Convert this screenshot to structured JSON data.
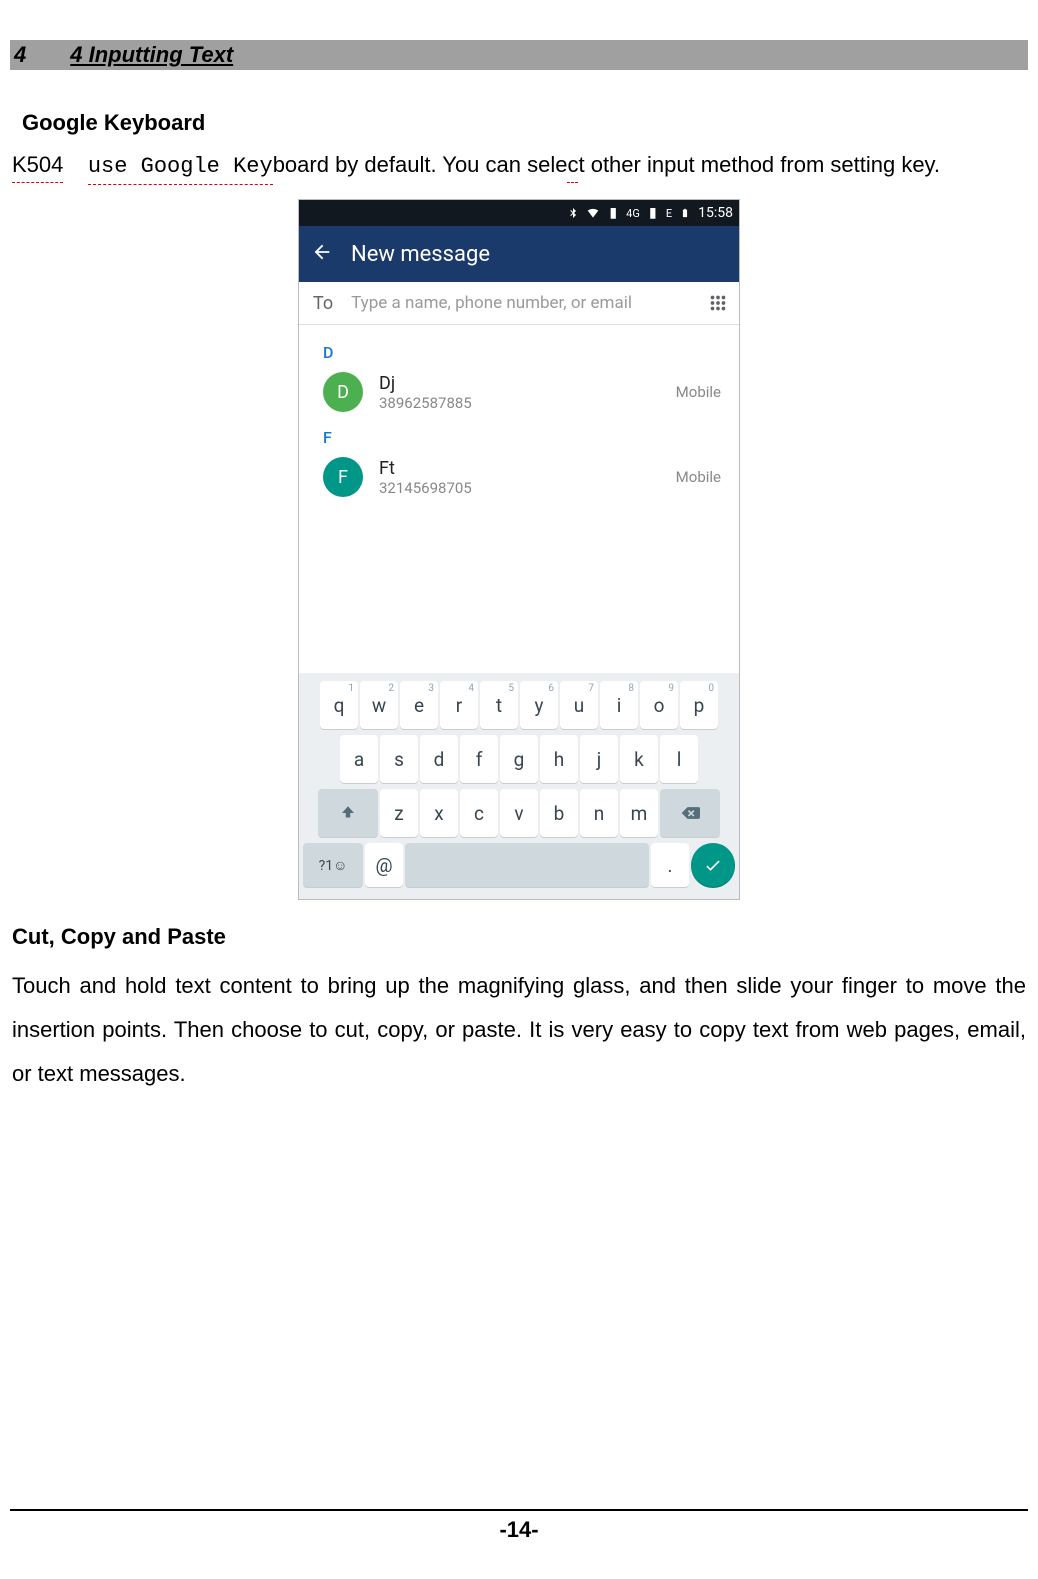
{
  "section": {
    "number": "4",
    "title": "4 Inputting Text"
  },
  "heading1": "Google Keyboard",
  "para1_pre": "K504",
  "para1_mid": "use Google Key",
  "para1_post": "board by default. You can sele",
  "para1_c": "c",
  "para1_end": "t other input method from setting key.",
  "heading2": "Cut, Copy and Paste",
  "para2": "Touch and hold text content to bring up the magnifying glass, and then slide your finger to move the insertion points. Then choose to cut, copy, or paste. It is very easy to copy text from web pages, email, or text messages.",
  "page_number": "-14-",
  "screenshot": {
    "status": {
      "net": "4G",
      "batt": "E",
      "time": "15:58"
    },
    "appbar": {
      "title": "New message"
    },
    "to": {
      "label": "To",
      "placeholder": "Type a name, phone number, or email"
    },
    "sections": [
      {
        "letter": "D",
        "contacts": [
          {
            "avatar_letter": "D",
            "avatar_color": "#4caf50",
            "name": "Dj",
            "number": "38962587885",
            "type": "Mobile"
          }
        ]
      },
      {
        "letter": "F",
        "contacts": [
          {
            "avatar_letter": "F",
            "avatar_color": "#009688",
            "name": "Ft",
            "number": "32145698705",
            "type": "Mobile"
          }
        ]
      }
    ],
    "keyboard": {
      "row1": [
        {
          "l": "q",
          "s": "1"
        },
        {
          "l": "w",
          "s": "2"
        },
        {
          "l": "e",
          "s": "3"
        },
        {
          "l": "r",
          "s": "4"
        },
        {
          "l": "t",
          "s": "5"
        },
        {
          "l": "y",
          "s": "6"
        },
        {
          "l": "u",
          "s": "7"
        },
        {
          "l": "i",
          "s": "8"
        },
        {
          "l": "o",
          "s": "9"
        },
        {
          "l": "p",
          "s": "0"
        }
      ],
      "row2": [
        "a",
        "s",
        "d",
        "f",
        "g",
        "h",
        "j",
        "k",
        "l"
      ],
      "row3": [
        "z",
        "x",
        "c",
        "v",
        "b",
        "n",
        "m"
      ],
      "sym": "?1☺",
      "at": "@",
      "dot": "."
    }
  }
}
